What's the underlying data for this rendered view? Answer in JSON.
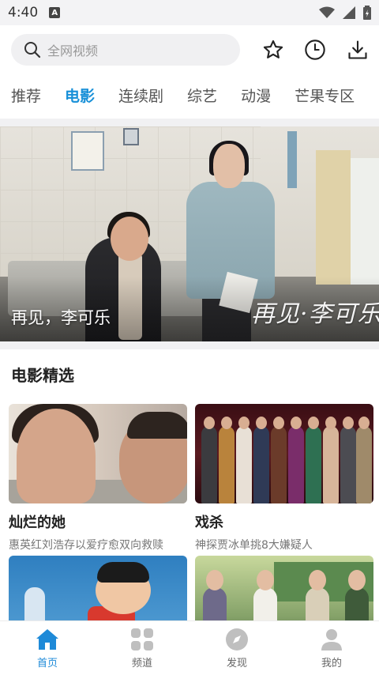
{
  "status_bar": {
    "time": "4:40",
    "notification_badge": "A"
  },
  "header": {
    "search_placeholder": "全网视频",
    "icons": [
      "star-icon",
      "history-clock-icon",
      "download-icon"
    ]
  },
  "tabs": [
    {
      "label": "推荐",
      "active": false
    },
    {
      "label": "电影",
      "active": true
    },
    {
      "label": "连续剧",
      "active": false
    },
    {
      "label": "综艺",
      "active": false
    },
    {
      "label": "动漫",
      "active": false
    },
    {
      "label": "芒果专区",
      "active": false
    }
  ],
  "banner": {
    "caption": "再见，李可乐",
    "logo_text": "再见·李可乐"
  },
  "section": {
    "title": "电影精选"
  },
  "cards": [
    {
      "title": "灿烂的她",
      "desc": "惠英红刘浩存以爱疗愈双向救赎"
    },
    {
      "title": "戏杀",
      "desc": "神探贾冰单挑8大嫌疑人"
    },
    {
      "title": "",
      "desc": ""
    },
    {
      "title": "",
      "desc": ""
    }
  ],
  "bottom_nav": [
    {
      "label": "首页",
      "icon": "home-icon",
      "active": true
    },
    {
      "label": "频道",
      "icon": "grid-icon",
      "active": false
    },
    {
      "label": "发现",
      "icon": "compass-icon",
      "active": false
    },
    {
      "label": "我的",
      "icon": "person-icon",
      "active": false
    }
  ],
  "colors": {
    "accent": "#1890d8",
    "nav_active": "#1e8ad8"
  }
}
